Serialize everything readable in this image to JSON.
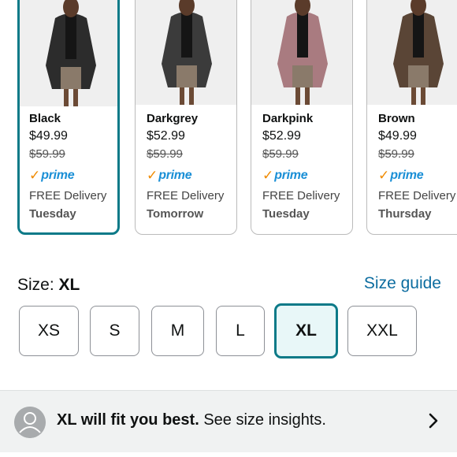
{
  "variants": [
    {
      "color_name": "Black",
      "price": "$49.99",
      "old_price": "$59.99",
      "prime": "prime",
      "delivery": "FREE Delivery",
      "day": "Tuesday",
      "swatch": "#2c2c2c",
      "selected": true
    },
    {
      "color_name": "Darkgrey",
      "price": "$52.99",
      "old_price": "$59.99",
      "prime": "prime",
      "delivery": "FREE Delivery",
      "day": "Tomorrow",
      "swatch": "#3b3b3b",
      "selected": false
    },
    {
      "color_name": "Darkpink",
      "price": "$52.99",
      "old_price": "$59.99",
      "prime": "prime",
      "delivery": "FREE Delivery",
      "day": "Tuesday",
      "swatch": "#a97b80",
      "selected": false
    },
    {
      "color_name": "Brown",
      "price": "$49.99",
      "old_price": "$59.99",
      "prime": "prime",
      "delivery": "FREE Delivery",
      "day": "Thursday",
      "swatch": "#5a4536",
      "selected": false
    }
  ],
  "size": {
    "label": "Size: ",
    "value": "XL",
    "guide": "Size guide",
    "options": [
      "XS",
      "S",
      "M",
      "L",
      "XL",
      "XXL"
    ],
    "selected": "XL"
  },
  "insight": {
    "bold": "XL will fit you best.",
    "rest": " See size insights."
  },
  "colors": {
    "accent": "#0c7a88",
    "link": "#0d6da0",
    "prime_blue": "#1a8fd6",
    "prime_check": "#f08a00"
  }
}
